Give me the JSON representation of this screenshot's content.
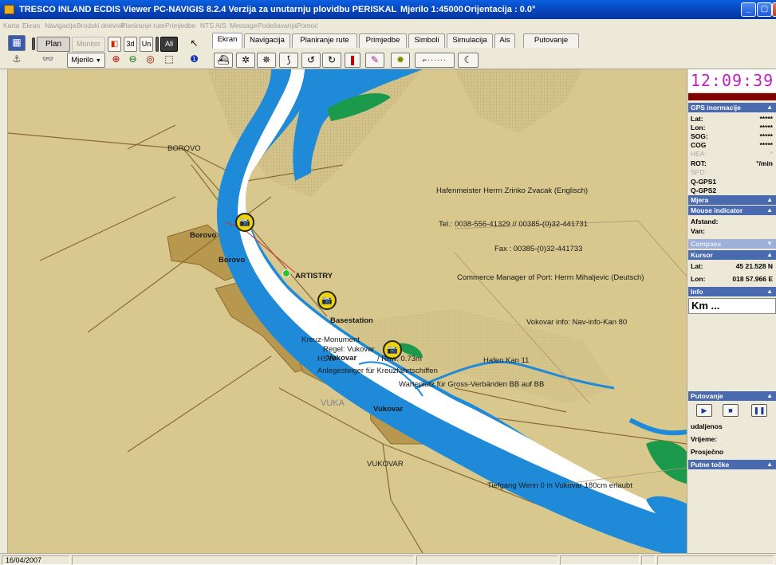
{
  "titlebar": {
    "title": "TRESCO INLAND ECDIS Viewer PC-NAVIGIS 8.2.4  Verzija za unutarnju plovidbu  PERISKAL",
    "scale": "Mjerilo 1:45000",
    "orientation": "Orijentacija :   0.0°"
  },
  "menu": [
    "Karta",
    "Ekran",
    "Navigacija",
    "Brodski dnevnik",
    "Planiranje rute",
    "Primjedbe",
    "NTS",
    "AIS",
    "Message",
    "Podešavanja",
    "Pomoć"
  ],
  "toolbar": {
    "plan": "Plan",
    "monitor": "Monitor",
    "mjerilo": "Mjerilo",
    "btn_3d": "3d",
    "btn_un": "Un",
    "btn_all": "All",
    "tabs": [
      "Ekran",
      "Navigacija",
      "Planiranje rute",
      "Primjedbe",
      "Simboli",
      "Simulacija",
      "Ais",
      "Putovanje"
    ]
  },
  "map": {
    "labels": {
      "borovo_town": "BOROVO",
      "borovo1": "Borovo",
      "borovo2": "Borovo",
      "artistry": "ARTISTRY",
      "basestation": "Basestation",
      "kreuz": "Kreuz-Monument",
      "regel": "Regel: Vukovar",
      "vukovar_b": "Vukovar",
      "hsw": "HSW",
      "rnw": "/ Rnw: 0.73m",
      "anleg": "Anlegesteiger für Kreuzfahrtschiffen",
      "vuka": "VUKA",
      "vukovar2": "Vukovar",
      "vukovar_town": "VUKOVAR",
      "hafenmeister": "Hafenmeister Herrn Zrinko Zvacak (Englisch)",
      "tel": "Tel.: 0038-556-41329  // 00385-(0)32-441731",
      "fax": "Fax : 00385-(0)32-441733",
      "commerce": "Commerce Manager of Port: Herrn Mihaljevic (Deutsch)",
      "vokovar_info": "Vokovar info: Nav-info-Kan 80",
      "hafen_kan": "Hafen Kan 11",
      "warteplatz": "Warteplatz für Gross-Verbänden BB auf BB",
      "tiefgang": "Tiefgang Wenn 0 in Vukovar 180cm erlaubt"
    }
  },
  "panel": {
    "clock": "12:09:39",
    "gps_header": "GPS inormacije",
    "gps_rows": [
      {
        "label": "Lat:",
        "value": "*****",
        "dim": false
      },
      {
        "label": "Lon:",
        "value": "*****",
        "dim": false
      },
      {
        "label": "SOG:",
        "value": "*****",
        "dim": false
      },
      {
        "label": "COG",
        "value": "*****",
        "dim": false
      },
      {
        "label": "HEA:",
        "value": "*",
        "dim": true
      },
      {
        "label": "ROT:",
        "value": "°/min",
        "dim": false
      },
      {
        "label": "SPD:",
        "value": "",
        "dim": true
      },
      {
        "label": "Q-GPS1",
        "value": "",
        "dim": false
      },
      {
        "label": "Q-GPS2",
        "value": "",
        "dim": false
      }
    ],
    "mjera": "Mjera",
    "mouse_indicator": "Mouse indicator",
    "afstand": "Afstand:",
    "van": "Van:",
    "compass": "Compass",
    "kursor": "Kursor",
    "kursor_lat_label": "Lat:",
    "kursor_lat": "45 21.528 N",
    "kursor_lon_label": "Lon:",
    "kursor_lon": "018 57.966 E",
    "info": "Info",
    "km": "Km ...",
    "putovanje": "Putovanje",
    "udaljenos": "udaljenos",
    "vrijeme": "Vrijeme:",
    "prosjecno": "Prosječno",
    "putne_tocke": "Putne točke"
  },
  "status": {
    "date": "16/04/2007"
  },
  "colors": {
    "land": "#d8c88e",
    "built": "#b8984e",
    "water": "#1e8ad8",
    "channel": "#ffffff",
    "panel_header": "#4a6ab0",
    "clock": "#c020c0"
  }
}
